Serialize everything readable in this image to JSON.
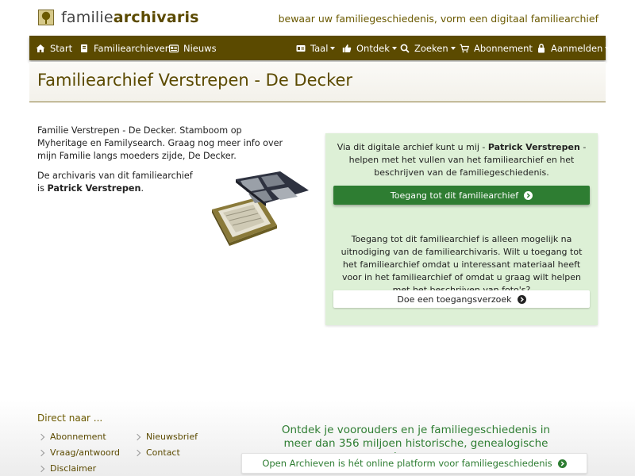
{
  "header": {
    "logo_prefix": "familie",
    "logo_bold": "archivaris",
    "tagline": "bewaar uw familiegeschiedenis, vorm een digitaal familiearchief"
  },
  "nav": {
    "left": [
      {
        "label": "Start",
        "icon": "home-icon"
      },
      {
        "label": "Familiearchieven",
        "icon": "book-icon"
      },
      {
        "label": "Nieuws",
        "icon": "newspaper-icon"
      }
    ],
    "right": [
      {
        "label": "Taal",
        "icon": "language-icon",
        "dropdown": true
      },
      {
        "label": "Ontdek",
        "icon": "thumbs-up-icon",
        "dropdown": true
      },
      {
        "label": "Zoeken",
        "icon": "search-icon",
        "dropdown": true
      },
      {
        "label": "Abonnement",
        "icon": "cart-icon",
        "dropdown": false
      },
      {
        "label": "Aanmelden",
        "icon": "lock-icon",
        "dropdown": true
      }
    ]
  },
  "page": {
    "title": "Familiearchief Verstrepen - De Decker",
    "intro": "Familie Verstrepen - De Decker. Stamboom op Myheritage en Familysearch. Graag nog meer info over mijn Familie langs moeders zijde, De Decker.",
    "archivist_prefix": "De archivaris van dit familiearchief is",
    "archivist_name": "Patrick Verstrepen",
    "archivist_suffix": "."
  },
  "panel": {
    "text1_prefix": "Via dit digitale archief kunt u mij -",
    "text1_name": "Patrick Verstrepen",
    "text1_suffix": "- helpen met het vullen van het familiearchief en het beschrijven van de familiegeschiedenis.",
    "access_button": "Toegang tot dit familiearchief",
    "text2": "Toegang tot dit familiearchief is alleen mogelijk na uitnodiging van de familiearchivaris. Wilt u toegang tot het familiearchief omdat u interessant materiaal heeft voor in het familiearchief of omdat u graag wilt helpen met het beschrijven van foto's?",
    "request_button": "Doe een toegangsverzoek"
  },
  "footer": {
    "heading": "Direct naar ...",
    "links": [
      "Abonnement",
      "Nieuwsbrief",
      "Vraag/antwoord",
      "Contact",
      "Disclaimer"
    ],
    "discover_text": "Ontdek je voorouders en je familiegeschiedenis in meer dan 356 miljoen historische, genealogische bronnen",
    "oa_button": "Open Archieven is hét online platform voor familiegeschiedenis"
  },
  "colors": {
    "brand": "#5b4a00",
    "accent_green": "#2e7d32",
    "panel_bg": "#ddf0d6"
  }
}
